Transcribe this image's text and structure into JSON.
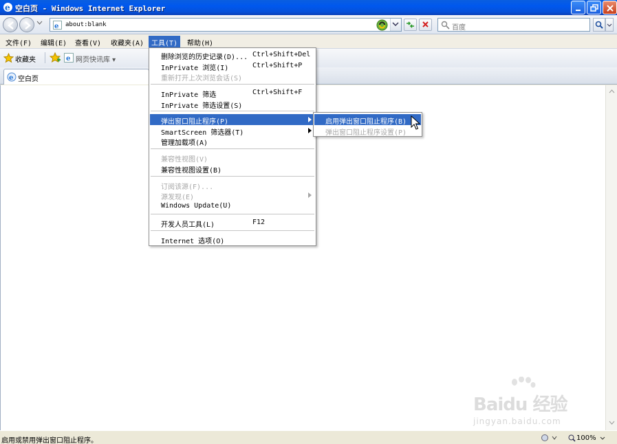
{
  "window": {
    "title": "空白页 - Windows Internet Explorer"
  },
  "address_bar": {
    "url": "about:blank"
  },
  "search": {
    "placeholder": "百度"
  },
  "menubar": {
    "items": [
      {
        "label": "文件(F)"
      },
      {
        "label": "编辑(E)"
      },
      {
        "label": "查看(V)"
      },
      {
        "label": "收藏夹(A)"
      },
      {
        "label": "工具(T)"
      },
      {
        "label": "帮助(H)"
      }
    ]
  },
  "favorites_bar": {
    "favorites_label": "收藏夹",
    "webslice_label": "网页快讯库 ▾"
  },
  "tab": {
    "label": "空白页"
  },
  "tools_menu": {
    "items": [
      {
        "label": "删除浏览的历史记录(D)...",
        "shortcut": "Ctrl+Shift+Del"
      },
      {
        "label": "InPrivate 浏览(I)",
        "shortcut": "Ctrl+Shift+P"
      },
      {
        "label": "重新打开上次浏览会话(S)",
        "shortcut": ""
      },
      {
        "label": "InPrivate 筛选",
        "shortcut": "Ctrl+Shift+F"
      },
      {
        "label": "InPrivate 筛选设置(S)",
        "shortcut": ""
      },
      {
        "label": "弹出窗口阻止程序(P)",
        "shortcut": ""
      },
      {
        "label": "SmartScreen 筛选器(T)",
        "shortcut": ""
      },
      {
        "label": "管理加载项(A)",
        "shortcut": ""
      },
      {
        "label": "兼容性视图(V)",
        "shortcut": ""
      },
      {
        "label": "兼容性视图设置(B)",
        "shortcut": ""
      },
      {
        "label": "订阅该源(F)...",
        "shortcut": ""
      },
      {
        "label": "源发现(E)",
        "shortcut": ""
      },
      {
        "label": "Windows Update(U)",
        "shortcut": ""
      },
      {
        "label": "开发人员工具(L)",
        "shortcut": "F12"
      },
      {
        "label": "Internet 选项(O)",
        "shortcut": ""
      }
    ]
  },
  "popup_submenu": {
    "items": [
      {
        "label": "启用弹出窗口阻止程序(B)"
      },
      {
        "label": "弹出窗口阻止程序设置(P)"
      }
    ]
  },
  "statusbar": {
    "text": "启用或禁用弹出窗口阻止程序。",
    "zoom": "100%"
  },
  "watermark": {
    "brand": "Baidu 经验",
    "url": "jingyan.baidu.com"
  },
  "colors": {
    "titlebar": "#0058ee",
    "menu_highlight": "#316ac5",
    "disabled_text": "#a7a7a7"
  }
}
